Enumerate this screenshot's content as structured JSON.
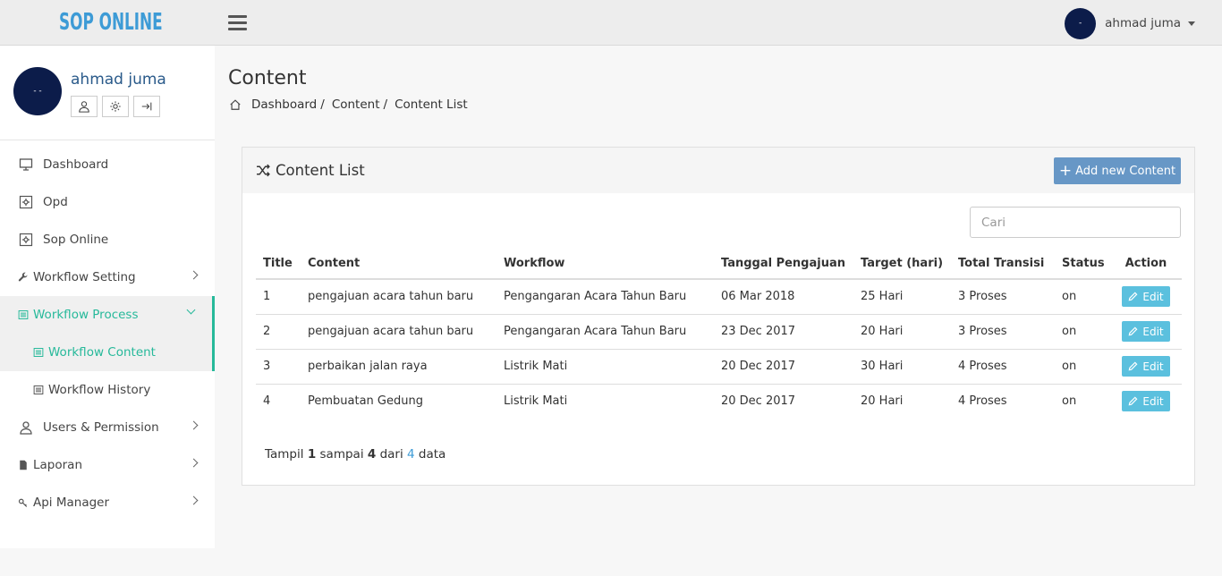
{
  "brand": "SOP ONLINE",
  "user": {
    "name": "ahmad juma",
    "avatar_text": "-",
    "avatar_text_lg": "- -"
  },
  "sidebar": {
    "items": [
      {
        "label": "Dashboard",
        "icon": "monitor-icon"
      },
      {
        "label": "Opd",
        "icon": "gear-square-icon"
      },
      {
        "label": "Sop Online",
        "icon": "gear-square-icon"
      },
      {
        "label": "Workflow Setting",
        "icon": "wrench-icon"
      },
      {
        "label": "Workflow Process",
        "icon": "list-icon"
      },
      {
        "label": "Workflow Content",
        "icon": "list-icon"
      },
      {
        "label": "Workflow History",
        "icon": "list-icon"
      },
      {
        "label": "Users & Permission",
        "icon": "user-icon"
      },
      {
        "label": "Laporan",
        "icon": "file-icon"
      },
      {
        "label": "Api Manager",
        "icon": "key-icon"
      }
    ]
  },
  "page": {
    "title": "Content",
    "breadcrumb": [
      "Dashboard",
      "Content",
      "Content List"
    ]
  },
  "panel": {
    "title": "Content List",
    "add_label": "Add new Content",
    "search_placeholder": "Cari"
  },
  "table": {
    "headers": [
      "Title",
      "Content",
      "Workflow",
      "Tanggal Pengajuan",
      "Target (hari)",
      "Total Transisi",
      "Status",
      "Action"
    ],
    "rows": [
      [
        "1",
        "pengajuan acara tahun baru",
        "Pengangaran Acara Tahun Baru",
        "06 Mar 2018",
        "25 Hari",
        "3 Proses",
        "on",
        "Edit"
      ],
      [
        "2",
        "pengajuan acara tahun baru",
        "Pengangaran Acara Tahun Baru",
        "23 Dec 2017",
        "20 Hari",
        "3 Proses",
        "on",
        "Edit"
      ],
      [
        "3",
        "perbaikan jalan raya",
        "Listrik Mati",
        "20 Dec 2017",
        "30 Hari",
        "4 Proses",
        "on",
        "Edit"
      ],
      [
        "4",
        "Pembuatan Gedung",
        "Listrik Mati",
        "20 Dec 2017",
        "20 Hari",
        "4 Proses",
        "on",
        "Edit"
      ]
    ]
  },
  "info": {
    "prefix": "Tampil",
    "from": "1",
    "mid": "sampai",
    "to": "4",
    "of": "dari",
    "total": "4",
    "suffix": "data"
  },
  "colors": {
    "brand": "#3d9bd6",
    "active": "#26b99a",
    "add_button": "#6797c6",
    "edit_button": "#5bc0de",
    "avatar": "#0c1c4a"
  }
}
